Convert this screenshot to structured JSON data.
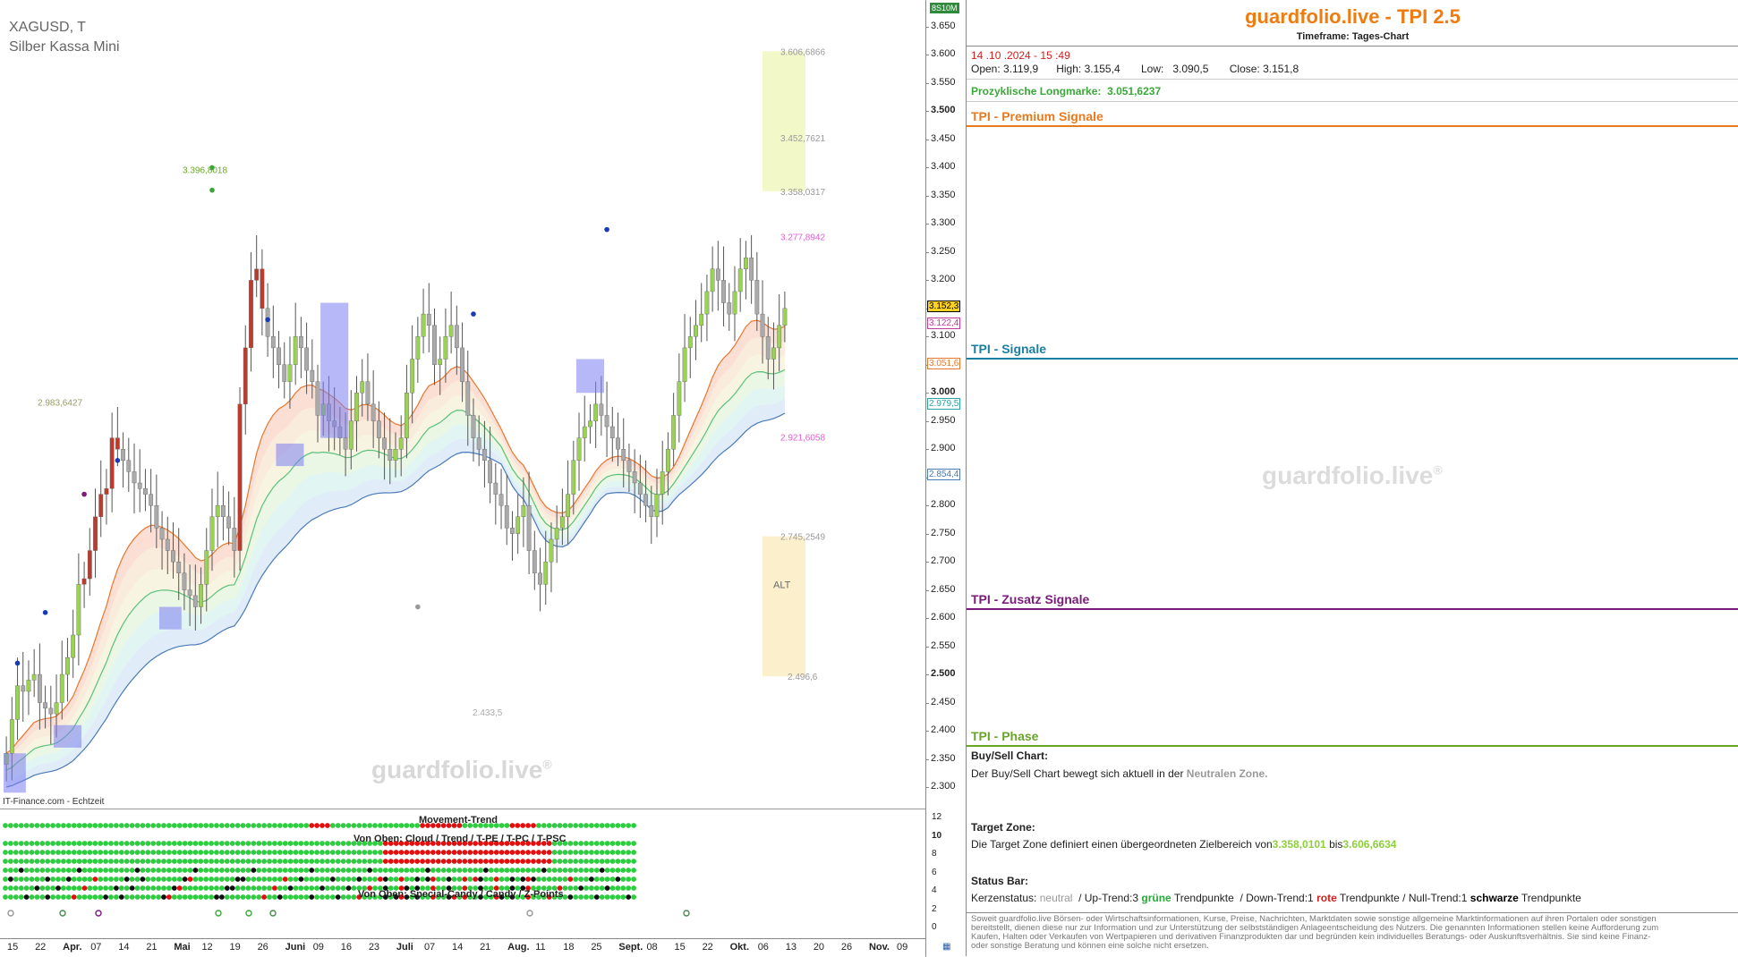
{
  "chart": {
    "symbol": "XAGUSD, T",
    "name": "Silber Kassa Mini",
    "watermark": "guardfolio.live",
    "watermark_reg": "®",
    "source": "IT-Finance.com - Echtzeit",
    "corner_badge": "8S10M"
  },
  "colors": {
    "brand": "#f07c10",
    "premium": "#e87a1e",
    "signale": "#1a7fa0",
    "zusatz": "#7a1a7a",
    "phase": "#6aa52a",
    "bull": "#7fd13a",
    "bear": "#c0392b"
  },
  "annotations": [
    {
      "text": "3.606,6866",
      "price": 3.6067,
      "color": "#999999"
    },
    {
      "text": "3.452,7621",
      "price": 3.4528,
      "color": "#999999"
    },
    {
      "text": "3.358,0317",
      "price": 3.358,
      "color": "#999999"
    },
    {
      "text": "3.277,8942",
      "price": 3.2779,
      "color": "#e060d0"
    },
    {
      "text": "2.921,6058",
      "price": 2.9216,
      "color": "#e060d0"
    },
    {
      "text": "2.745,2549",
      "price": 2.7453,
      "color": "#999999"
    },
    {
      "text": "ALT",
      "price": 2.66,
      "color": "#666666"
    },
    {
      "text": "2.496,6",
      "price": 2.4966,
      "color": "#999999"
    },
    {
      "text": "3.396,8018",
      "price": 3.3968,
      "color": "#6aa52a"
    },
    {
      "text": "2.983,6427",
      "price": 2.9836,
      "color": "#999966"
    },
    {
      "text": "2.433,5",
      "price": 2.4335,
      "color": "#aaaaaa"
    }
  ],
  "chart_data": {
    "type": "candlestick",
    "title": "XAGUSD, T",
    "subtitle": "Silber Kassa Mini",
    "ylim": [
      2.26,
      3.68
    ],
    "y_ticks": [
      "3.650",
      "3.600",
      "3.550",
      "3.500",
      "3.450",
      "3.400",
      "3.350",
      "3.300",
      "3.250",
      "3.200",
      "3.150",
      "3.100",
      "3.050",
      "3.000",
      "2.950",
      "2.900",
      "2.850",
      "2.800",
      "2.750",
      "2.700",
      "2.650",
      "2.600",
      "2.550",
      "2.500",
      "2.450",
      "2.400",
      "2.350",
      "2.300"
    ],
    "y_tick_values": [
      3.65,
      3.6,
      3.55,
      3.5,
      3.45,
      3.4,
      3.35,
      3.3,
      3.25,
      3.2,
      3.15,
      3.1,
      3.05,
      3.0,
      2.95,
      2.9,
      2.85,
      2.8,
      2.75,
      2.7,
      2.65,
      2.6,
      2.55,
      2.5,
      2.45,
      2.4,
      2.35,
      2.3
    ],
    "bold_ticks": [
      3.5,
      3.0,
      2.5
    ],
    "x_ticks": [
      "15",
      "22",
      "Apr.",
      "07",
      "14",
      "21",
      "Mai",
      "12",
      "19",
      "26",
      "Juni",
      "09",
      "16",
      "23",
      "Juli",
      "07",
      "14",
      "21",
      "Aug.",
      "11",
      "18",
      "25",
      "Sept.",
      "08",
      "15",
      "22",
      "Okt.",
      "06",
      "13",
      "20",
      "26",
      "Nov.",
      "09"
    ],
    "bold_x_ticks": [
      "Apr.",
      "Mai",
      "Juni",
      "Juli",
      "Aug.",
      "Sept.",
      "Okt.",
      "Nov."
    ],
    "price_labels": [
      {
        "text": "3.152,3",
        "value": 3.1523,
        "bg": "#ffd21f",
        "fg": "#000000"
      },
      {
        "text": "3.122,4",
        "value": 3.1224,
        "bg": "#ffffff",
        "fg": "#c0399b"
      },
      {
        "text": "3.051,6",
        "value": 3.0516,
        "bg": "#ffffff",
        "fg": "#e8772e"
      },
      {
        "text": "2.979,5",
        "value": 2.9795,
        "bg": "#ffffff",
        "fg": "#2aa1a0"
      },
      {
        "text": "2.854,4",
        "value": 2.8544,
        "bg": "#ffffff",
        "fg": "#4a7ab8"
      }
    ],
    "series": [
      {
        "name": "Close",
        "values": [
          2.36,
          2.42,
          2.48,
          2.47,
          2.49,
          2.5,
          2.45,
          2.44,
          2.43,
          2.45,
          2.5,
          2.53,
          2.57,
          2.66,
          2.67,
          2.72,
          2.78,
          2.82,
          2.83,
          2.92,
          2.9,
          2.88,
          2.86,
          2.84,
          2.83,
          2.82,
          2.8,
          2.76,
          2.74,
          2.72,
          2.7,
          2.68,
          2.65,
          2.64,
          2.62,
          2.66,
          2.72,
          2.78,
          2.8,
          2.78,
          2.76,
          2.72,
          2.98,
          3.08,
          3.2,
          3.22,
          3.15,
          3.1,
          3.08,
          3.05,
          3.02,
          3.05,
          3.1,
          3.08,
          3.04,
          3.02,
          2.96,
          2.98,
          2.95,
          2.94,
          2.92,
          2.9,
          2.95,
          3.0,
          3.02,
          2.98,
          2.95,
          2.92,
          2.9,
          2.88,
          2.9,
          2.92,
          3.0,
          3.06,
          3.1,
          3.14,
          3.12,
          3.05,
          3.06,
          3.1,
          3.12,
          3.08,
          3.02,
          2.96,
          2.92,
          2.9,
          2.88,
          2.84,
          2.82,
          2.8,
          2.76,
          2.75,
          2.78,
          2.8,
          2.72,
          2.68,
          2.66,
          2.7,
          2.74,
          2.76,
          2.78,
          2.82,
          2.88,
          2.92,
          2.94,
          2.95,
          2.98,
          2.96,
          2.94,
          2.92,
          2.9,
          2.88,
          2.86,
          2.84,
          2.82,
          2.8,
          2.78,
          2.82,
          2.86,
          2.9,
          2.96,
          3.02,
          3.08,
          3.1,
          3.12,
          3.14,
          3.18,
          3.22,
          3.2,
          3.16,
          3.14,
          3.18,
          3.22,
          3.24,
          3.2,
          3.14,
          3.1,
          3.06,
          3.08,
          3.12,
          3.15
        ]
      }
    ],
    "ema_bands": true,
    "target_zone": {
      "low": 3.358,
      "high": 3.6067
    },
    "alt_zone": {
      "low": 2.4966,
      "high": 2.7453
    }
  },
  "indicators": {
    "movement_title": "Movement-Trend",
    "cloud_title": "Von Oben: Cloud / Trend / T-PE / T-PC / T-PSC",
    "special_title": "Von Oben: Special-Candy / Candy / Z-Points",
    "scale": [
      "12",
      "10",
      "8",
      "6",
      "4",
      "2",
      "0"
    ],
    "scale_bold": "10"
  },
  "panel": {
    "title": "guardfolio.live - TPI 2.5",
    "timeframe": "Timeframe: Tages-Chart",
    "datetime": "14 .10 .2024  - 15 :49",
    "ohlc": {
      "open_label": "Open:",
      "open": "3.119,9",
      "high_label": "High:",
      "high": "3.155,4",
      "low_label": "Low:",
      "low": "3.090,5",
      "close_label": "Close:",
      "close": "3.151,8"
    },
    "longmarke_label": "Prozyklische Longmarke:",
    "longmarke_value": "3.051,6237",
    "sections": {
      "premium": "TPI - Premium Signale",
      "signale": "TPI - Signale",
      "zusatz": "TPI - Zusatz Signale",
      "phase": "TPI - Phase"
    },
    "watermark": "guardfolio.live",
    "watermark_reg": "®",
    "buysell_head": "Buy/Sell Chart:",
    "buysell_text": "Der Buy/Sell Chart bewegt sich aktuell in der",
    "buysell_zone": "Neutralen Zone.",
    "target_head": "Target Zone:",
    "target_text": "Die Target Zone definiert einen übergeordneten Zielbereich von",
    "target_low": "3.358,0101",
    "target_mid": "bis",
    "target_high": "3.606,6634",
    "status_head": "Status Bar:",
    "status": {
      "kerzen_label": "Kerzenstatus:",
      "kerzen_value": "neutral",
      "up_label": "/ Up-Trend:",
      "up_count": "3",
      "up_word": "grüne",
      "tp1": "Trendpunkte",
      "down_label": "/ Down-Trend:",
      "down_count": "1",
      "down_word": "rote",
      "tp2": "Trendpunkte",
      "null_label": "/ Null-Trend:",
      "null_count": "1",
      "null_word": "schwarze",
      "tp3": "Trendpunkte"
    },
    "disclaimer": "Soweit guardfolio.live Börsen- oder Wirtschaftsinformationen, Kurse, Preise, Nachrichten, Marktdaten sowie sonstige allgemeine Marktinformationen auf ihren Portalen oder sonstigen bereitstellt, dienen diese nur zur Information und zur Unterstützung der selbstständigen Anlageentscheidung des Nutzers. Die genannten Informationen stellen keine Aufforderung zum Kaufen, Halten oder Verkaufen von Wertpapieren und derivativen Finanzprodukten dar und begründen kein individuelles Beratungs- oder Auskunftsverhältnis. Sie sind keine Finanz- oder sonstige Beratung und können eine solche nicht ersetzen."
  }
}
